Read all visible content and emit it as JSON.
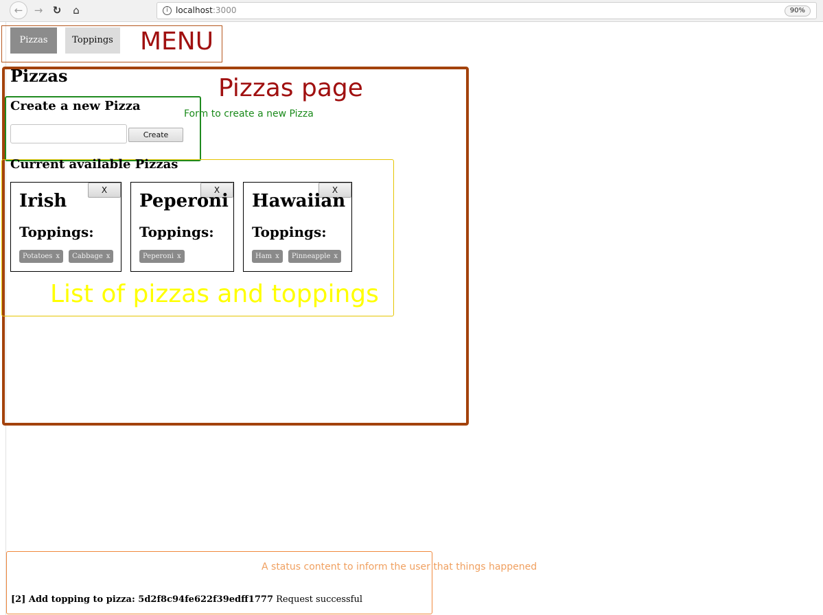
{
  "browser": {
    "back_icon": "arrow-left-icon",
    "forward_icon": "arrow-right-icon",
    "reload_icon": "reload-icon",
    "home_icon": "home-icon",
    "url_host": "localhost",
    "url_port": ":3000",
    "zoom": "90%"
  },
  "menu": {
    "items": [
      {
        "label": "Pizzas",
        "active": true
      },
      {
        "label": "Toppings",
        "active": false
      }
    ],
    "annotation": "MENU"
  },
  "page": {
    "title": "Pizzas",
    "annotation": "Pizzas page",
    "form": {
      "title": "Create a new Pizza",
      "input_value": "",
      "create_label": "Create",
      "annotation": "Form to create a new Pizza"
    },
    "list": {
      "title": "Current available Pizzas",
      "annotation": "List of pizzas and toppings",
      "delete_label": "X",
      "toppings_heading": "Toppings:",
      "chip_remove": "x",
      "pizzas": [
        {
          "name": "Irish",
          "toppings": [
            "Potatoes",
            "Cabbage"
          ]
        },
        {
          "name": "Peperoni",
          "toppings": [
            "Peperoni"
          ]
        },
        {
          "name": "Hawaiian",
          "toppings": [
            "Ham",
            "Pinneapple"
          ]
        }
      ]
    }
  },
  "status": {
    "annotation": "A status content to inform the user that things happened",
    "prefix": "[2] Add topping to pizza: 5d2f8c94fe622f39edff1777",
    "message": "Request successful"
  },
  "colors": {
    "menu_border": "#b5561c",
    "page_border": "#a3420c",
    "form_border": "#1f8a1f",
    "list_border": "#e5c400",
    "status_border": "#f0883c",
    "annotation_red": "#a01010",
    "annotation_yellow": "#ffff00",
    "annotation_green": "#1a8a1a",
    "annotation_orange": "#f0a060"
  }
}
